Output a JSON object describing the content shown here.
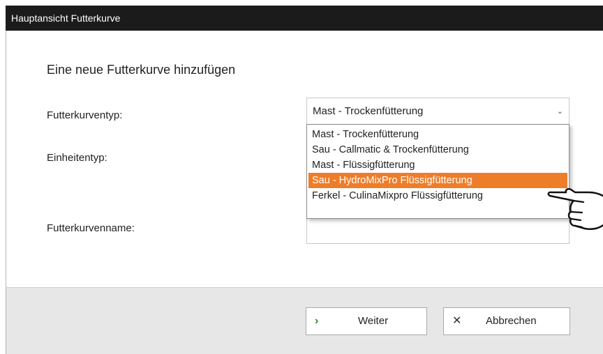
{
  "window": {
    "title": "Hauptansicht Futterkurve"
  },
  "form": {
    "heading": "Eine neue Futterkurve hinzufügen",
    "type_label": "Futterkurventyp:",
    "unit_label": "Einheitentyp:",
    "name_label": "Futterkurvenname:",
    "type_value": "Mast - Trockenfütterung",
    "name_value": ""
  },
  "dropdown": {
    "options": [
      "Mast - Trockenfütterung",
      "Sau - Callmatic & Trockenfütterung",
      "Mast - Flüssigfütterung",
      "Sau - HydroMixPro Flüssigfütterung",
      "Ferkel - CulinaMixpro Flüssigfütterung"
    ],
    "highlighted_index": 3
  },
  "buttons": {
    "next_label": "Weiter",
    "cancel_label": "Abbrechen"
  },
  "colors": {
    "highlight": "#ee7d2a",
    "titlebar": "#1b1b1b",
    "next_icon": "#2e8b2e"
  },
  "icons": {
    "next": "chevron-right-icon",
    "cancel": "close-icon",
    "select": "chevron-down-icon",
    "pointer": "pointing-hand-icon"
  }
}
